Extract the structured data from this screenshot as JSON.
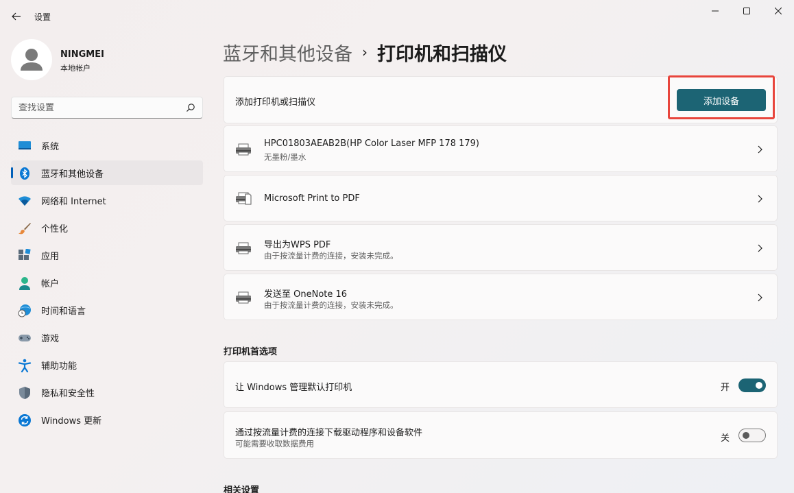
{
  "window": {
    "title": "设置"
  },
  "user": {
    "name": "NINGMEI",
    "account_type": "本地帐户"
  },
  "search": {
    "placeholder": "查找设置"
  },
  "sidebar": {
    "items": [
      {
        "label": "系统",
        "icon": "monitor-icon",
        "active": false
      },
      {
        "label": "蓝牙和其他设备",
        "icon": "bluetooth-icon",
        "active": true
      },
      {
        "label": "网络和 Internet",
        "icon": "wifi-icon",
        "active": false
      },
      {
        "label": "个性化",
        "icon": "paintbrush-icon",
        "active": false
      },
      {
        "label": "应用",
        "icon": "apps-icon",
        "active": false
      },
      {
        "label": "帐户",
        "icon": "person-icon",
        "active": false
      },
      {
        "label": "时间和语言",
        "icon": "globe-clock-icon",
        "active": false
      },
      {
        "label": "游戏",
        "icon": "gamepad-icon",
        "active": false
      },
      {
        "label": "辅助功能",
        "icon": "accessibility-icon",
        "active": false
      },
      {
        "label": "隐私和安全性",
        "icon": "shield-icon",
        "active": false
      },
      {
        "label": "Windows 更新",
        "icon": "update-icon",
        "active": false
      }
    ]
  },
  "breadcrumb": {
    "parent": "蓝牙和其他设备",
    "separator": "›",
    "current": "打印机和扫描仪"
  },
  "add_printer": {
    "label": "添加打印机或扫描仪",
    "button": "添加设备"
  },
  "devices": [
    {
      "name": "HPC01803AEAB2B(HP Color Laser MFP 178 179)",
      "status": "无墨粉/墨水",
      "icon": "printer-icon"
    },
    {
      "name": "Microsoft Print to PDF",
      "status": "",
      "icon": "pdf-printer-icon"
    },
    {
      "name": "导出为WPS PDF",
      "status": "由于按流量计费的连接，安装未完成。",
      "icon": "printer-icon"
    },
    {
      "name": "发送至 OneNote 16",
      "status": "由于按流量计费的连接，安装未完成。",
      "icon": "printer-icon"
    }
  ],
  "preferences": {
    "title": "打印机首选项",
    "items": [
      {
        "label": "让 Windows 管理默认打印机",
        "sublabel": "",
        "state_label": "开",
        "on": true
      },
      {
        "label": "通过按流量计费的连接下载驱动程序和设备软件",
        "sublabel": "可能需要收取数据费用",
        "state_label": "关",
        "on": false
      }
    ]
  },
  "related": {
    "title": "相关设置"
  },
  "colors": {
    "accent": "#1c6474",
    "highlight": "#e8453c",
    "nav_indicator": "#005fb8"
  }
}
